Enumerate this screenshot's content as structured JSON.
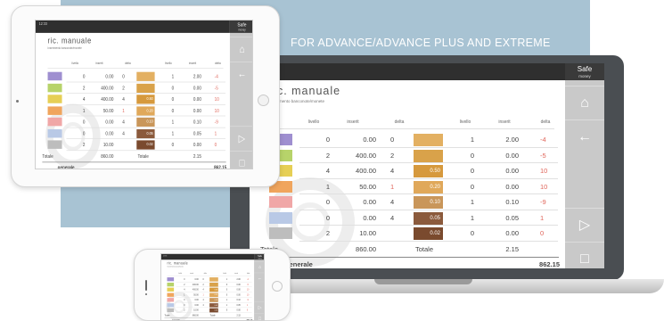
{
  "banner": {
    "headline": "FOR ADVANCE/ADVANCE PLUS AND EXTREME"
  },
  "colors": {
    "banner_blue": "#a8c3d3",
    "sidebar_gray": "#c9c9c9",
    "topbar_dark": "#2f2f2f",
    "negative_red": "#e0655a",
    "swatches": [
      "#9f8fd0",
      "#b7d36a",
      "#e6cf55",
      "#f0a55d",
      "#f0a7a7",
      "#b9c9e6",
      "#bdbdbd"
    ],
    "coin_boxes": [
      "#e3b062",
      "#d9a24a",
      "#d6993d",
      "#e0a85a",
      "#c9965a",
      "#8b5a3c",
      "#7a4a2e"
    ]
  },
  "app": {
    "topbar_text": "12:33",
    "brand_name": "Safe",
    "brand_sub": "money",
    "title": "ric. manuale",
    "subtitle": "Inserimento banconote/monete",
    "sidebar_buttons": [
      {
        "icon": "home-icon",
        "glyph": "⌂"
      },
      {
        "icon": "back-arrow-icon",
        "glyph": "←"
      },
      {
        "icon": "play-icon",
        "glyph": "▷"
      },
      {
        "icon": "stop-icon",
        "glyph": "□"
      }
    ],
    "columns_left": [
      "livello",
      "inserit",
      "delta"
    ],
    "columns_right": [
      "livello",
      "inserit",
      "delta"
    ],
    "rows": [
      {
        "l_level": "0",
        "l_value": "0.00",
        "l_delta": "0",
        "coin": "",
        "r_level": "1",
        "r_value": "2.00",
        "r_delta": "-4"
      },
      {
        "l_level": "2",
        "l_value": "400.00",
        "l_delta": "2",
        "coin": "",
        "r_level": "0",
        "r_value": "0.00",
        "r_delta": "-5"
      },
      {
        "l_level": "4",
        "l_value": "400.00",
        "l_delta": "4",
        "coin": "0.50",
        "r_level": "0",
        "r_value": "0.00",
        "r_delta": "10"
      },
      {
        "l_level": "1",
        "l_value": "50.00",
        "l_delta": "1",
        "coin": "0.20",
        "r_level": "0",
        "r_value": "0.00",
        "r_delta": "10"
      },
      {
        "l_level": "0",
        "l_value": "0.00",
        "l_delta": "4",
        "coin": "0.10",
        "r_level": "1",
        "r_value": "0.10",
        "r_delta": "-9"
      },
      {
        "l_level": "0",
        "l_value": "0.00",
        "l_delta": "4",
        "coin": "0.05",
        "r_level": "1",
        "r_value": "0.05",
        "r_delta": "1"
      },
      {
        "l_level": "2",
        "l_value": "10.00",
        "l_delta": "",
        "coin": "0.02",
        "r_level": "0",
        "r_value": "0.00",
        "r_delta": "0"
      }
    ],
    "totals": {
      "left_label": "Totale",
      "left_value": "860.00",
      "right_label": "Totale",
      "right_value": "2.15",
      "grand_label": "generale",
      "grand_value": "862.15"
    }
  }
}
